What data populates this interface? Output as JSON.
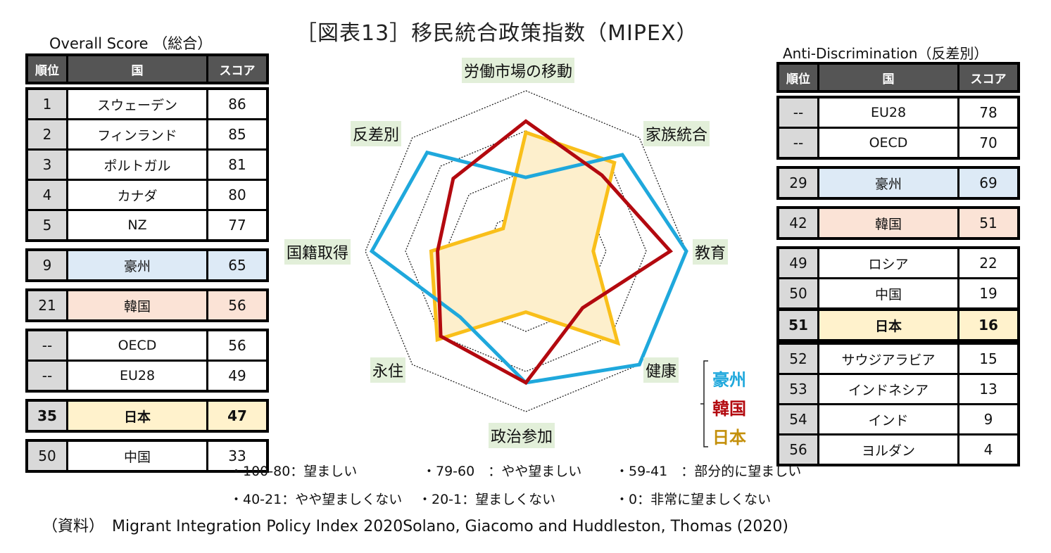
{
  "title": "［図表13］移民統合政策指数（MIPEX）",
  "overall": {
    "title": "Overall Score （総合）",
    "headers": [
      "順位",
      "国",
      "スコア"
    ],
    "groups": [
      {
        "highlight": "",
        "rows": [
          {
            "rank": "1",
            "country": "スウェーデン",
            "score": "86"
          },
          {
            "rank": "2",
            "country": "フィンランド",
            "score": "85"
          },
          {
            "rank": "3",
            "country": "ポルトガル",
            "score": "81"
          },
          {
            "rank": "4",
            "country": "カナダ",
            "score": "80"
          },
          {
            "rank": "5",
            "country": "NZ",
            "score": "77"
          }
        ]
      },
      {
        "highlight": "aus",
        "rows": [
          {
            "rank": "9",
            "country": "豪州",
            "score": "65"
          }
        ]
      },
      {
        "highlight": "kor",
        "rows": [
          {
            "rank": "21",
            "country": "韓国",
            "score": "56"
          }
        ]
      },
      {
        "highlight": "",
        "rows": [
          {
            "rank": "--",
            "country": "OECD",
            "score": "56"
          },
          {
            "rank": "--",
            "country": "EU28",
            "score": "49"
          }
        ]
      },
      {
        "highlight": "jpn",
        "rows": [
          {
            "rank": "35",
            "country": "日本",
            "score": "47"
          }
        ]
      },
      {
        "highlight": "",
        "rows": [
          {
            "rank": "50",
            "country": "中国",
            "score": "33"
          }
        ]
      }
    ]
  },
  "antidisc": {
    "title": "Anti-Discrimination（反差別）",
    "headers": [
      "順位",
      "国",
      "スコア"
    ],
    "groups": [
      {
        "highlight": "",
        "rows": [
          {
            "rank": "--",
            "country": "EU28",
            "score": "78"
          },
          {
            "rank": "--",
            "country": "OECD",
            "score": "70"
          }
        ]
      },
      {
        "highlight": "aus",
        "rows": [
          {
            "rank": "29",
            "country": "豪州",
            "score": "69"
          }
        ]
      },
      {
        "highlight": "kor",
        "rows": [
          {
            "rank": "42",
            "country": "韓国",
            "score": "51"
          }
        ]
      },
      {
        "highlight": "",
        "rows": [
          {
            "rank": "49",
            "country": "ロシア",
            "score": "22"
          },
          {
            "rank": "50",
            "country": "中国",
            "score": "19"
          },
          {
            "rank": "51",
            "country": "日本",
            "score": "16",
            "highlight": "jpn"
          },
          {
            "rank": "52",
            "country": "サウジアラビア",
            "score": "15"
          },
          {
            "rank": "53",
            "country": "インドネシア",
            "score": "13"
          },
          {
            "rank": "54",
            "country": "インド",
            "score": "9"
          },
          {
            "rank": "56",
            "country": "ヨルダン",
            "score": "4"
          }
        ]
      }
    ]
  },
  "chart_data": {
    "type": "radar",
    "title": "移民統合政策指数（MIPEX）",
    "axes": [
      "労働市場の移動",
      "家族統合",
      "教育",
      "健康",
      "政治参加",
      "永住",
      "国籍取得",
      "反差別"
    ],
    "range": [
      0,
      100
    ],
    "gridlines": [
      25,
      50,
      75,
      100
    ],
    "series": [
      {
        "name": "豪州",
        "color": "#1fa8dc",
        "fill": false,
        "values": [
          46,
          85,
          100,
          100,
          82,
          58,
          96,
          87
        ]
      },
      {
        "name": "韓国",
        "color": "#b3090f",
        "fill": false,
        "values": [
          81,
          67,
          90,
          50,
          82,
          75,
          55,
          64
        ]
      },
      {
        "name": "日本",
        "color": "#f9bf1a",
        "fill": true,
        "fill_color": "#fdefcc",
        "values": [
          74,
          78,
          42,
          81,
          38,
          78,
          59,
          20
        ]
      }
    ],
    "legend": [
      {
        "label": "豪州",
        "color": "#1fa8dc"
      },
      {
        "label": "韓国",
        "color": "#b3090f"
      },
      {
        "label": "日本",
        "color": "#c4900c"
      }
    ]
  },
  "notes": {
    "row1": [
      "・100-80：望ましい",
      "・79-60　：やや望ましい",
      "・59-41　：部分的に望ましい"
    ],
    "row2": [
      "・40-21：やや望ましくない",
      "・20-1：望ましくない",
      "・0：非常に望ましくない"
    ]
  },
  "source": "（資料）　Migrant Integration Policy Index 2020Solano, Giacomo and Huddleston, Thomas (2020)"
}
